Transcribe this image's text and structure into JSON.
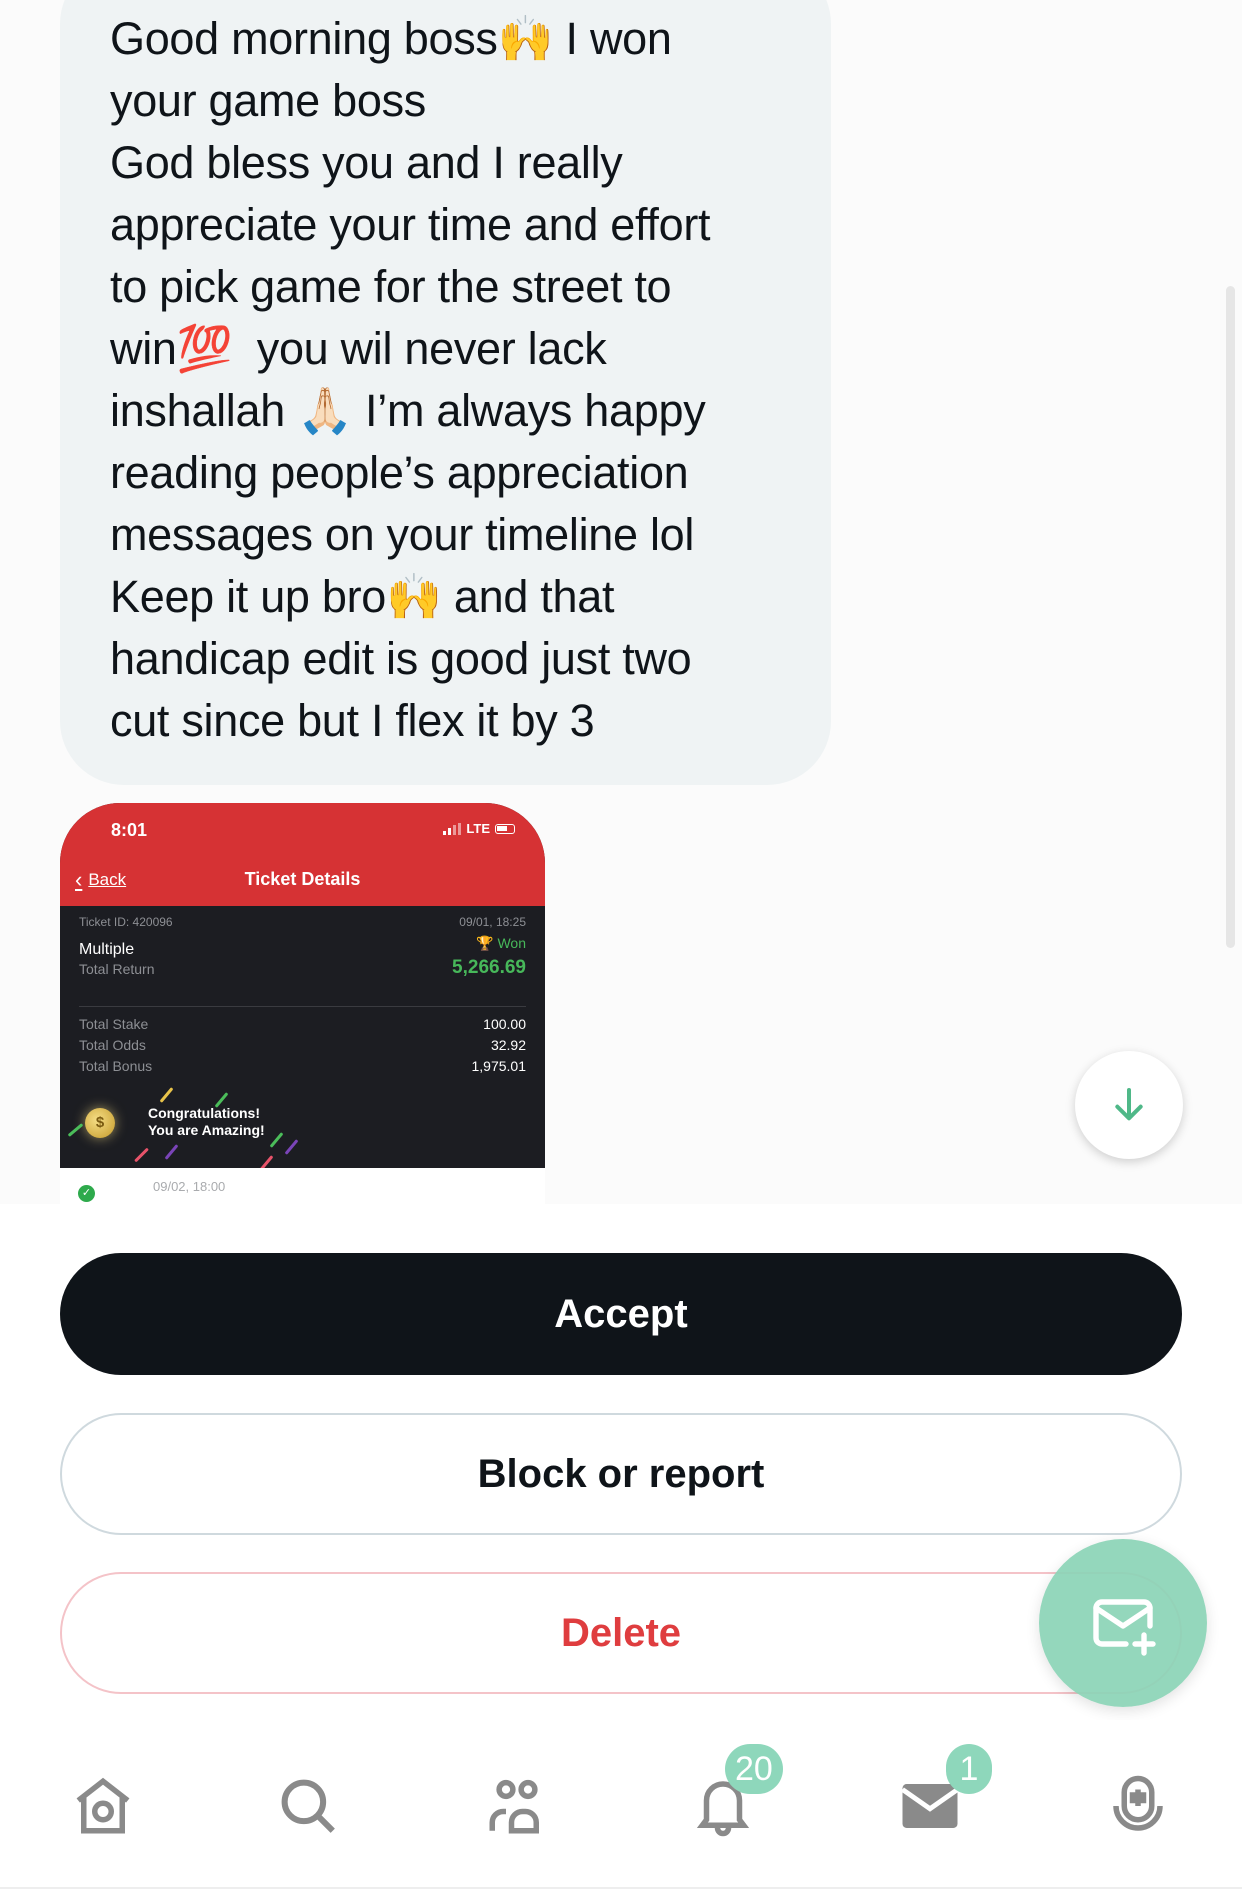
{
  "message": {
    "text": "Good morning boss🙌 I won\nyour game boss\nGod bless you and I really\nappreciate your time and effort\nto pick game for the street to\nwin💯  you wil never lack\ninshallah 🙏🏻 I’m always happy\nreading people’s appreciation\nmessages on your timeline lol\nKeep it up bro🙌 and that\nhandicap edit is good just two\ncut since but I flex it by 3"
  },
  "attachment": {
    "status_time": "8:01",
    "network": "LTE",
    "back_label": "Back",
    "title": "Ticket Details",
    "ticket_id": "Ticket ID: 420096",
    "placed_at": "09/01, 18:25",
    "bet_type": "Multiple",
    "result": "Won",
    "total_return_label": "Total Return",
    "total_return": "5,266.69",
    "rows": [
      {
        "label": "Total Stake",
        "value": "100.00"
      },
      {
        "label": "Total Odds",
        "value": "32.92"
      },
      {
        "label": "Total Bonus",
        "value": "1,975.01"
      }
    ],
    "congrats_line1": "Congratulations!",
    "congrats_line2": "You are Amazing!",
    "coin_symbol": "$",
    "leg_date": "09/02, 18:00"
  },
  "actions": {
    "accept": "Accept",
    "block": "Block or report",
    "delete": "Delete"
  },
  "nav": {
    "items": [
      {
        "name": "home",
        "icon": "home-icon"
      },
      {
        "name": "search",
        "icon": "search-icon"
      },
      {
        "name": "communities",
        "icon": "communities-icon"
      },
      {
        "name": "notifications",
        "icon": "bell-icon",
        "badge": "20"
      },
      {
        "name": "messages",
        "icon": "mail-icon",
        "badge": "1"
      },
      {
        "name": "spaces",
        "icon": "spaces-icon"
      }
    ]
  },
  "colors": {
    "accent": "#8ed7bb",
    "danger": "#df3d3f",
    "primary_button": "#0f1419",
    "bubble": "#eff3f4"
  }
}
